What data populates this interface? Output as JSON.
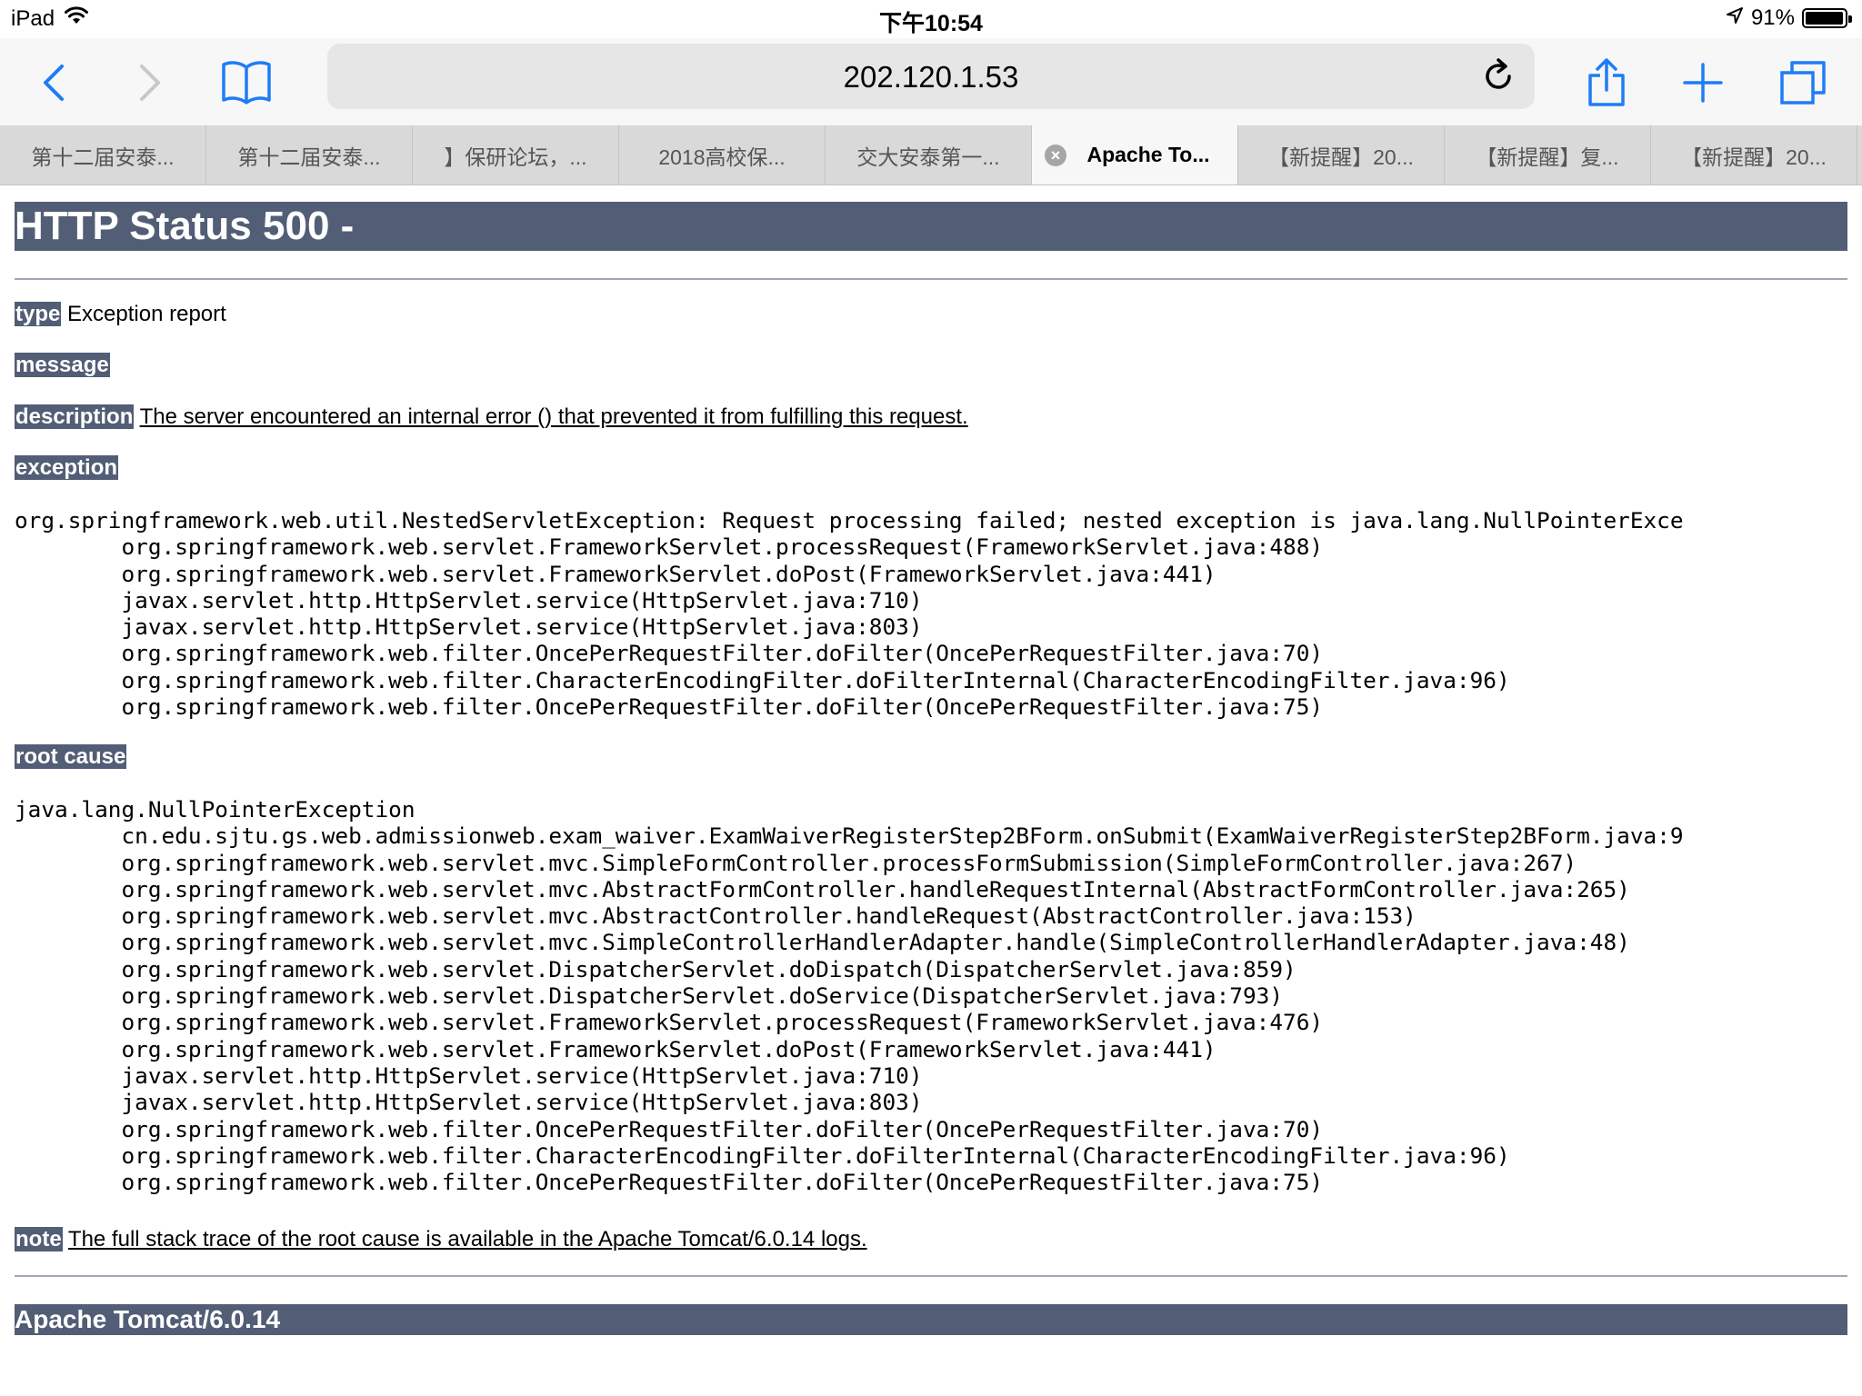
{
  "status_bar": {
    "device": "iPad",
    "time": "下午10:54",
    "battery": "91%"
  },
  "browser": {
    "url": "202.120.1.53",
    "tabs": [
      {
        "label": "第十二届安泰..."
      },
      {
        "label": "第十二届安泰..."
      },
      {
        "label": "】保研论坛，..."
      },
      {
        "label": "2018高校保..."
      },
      {
        "label": "交大安泰第一..."
      },
      {
        "label": "Apache To...",
        "active": true
      },
      {
        "label": "【新提醒】20..."
      },
      {
        "label": "【新提醒】复..."
      },
      {
        "label": "【新提醒】20..."
      }
    ]
  },
  "page": {
    "title": "HTTP Status 500 -",
    "type_label": "type",
    "type_value": "Exception report",
    "message_label": "message",
    "description_label": "description",
    "description_value": "The server encountered an internal error () that prevented it from fulfilling this request.",
    "exception_label": "exception",
    "exception_trace": "org.springframework.web.util.NestedServletException: Request processing failed; nested exception is java.lang.NullPointerExce\n\torg.springframework.web.servlet.FrameworkServlet.processRequest(FrameworkServlet.java:488)\n\torg.springframework.web.servlet.FrameworkServlet.doPost(FrameworkServlet.java:441)\n\tjavax.servlet.http.HttpServlet.service(HttpServlet.java:710)\n\tjavax.servlet.http.HttpServlet.service(HttpServlet.java:803)\n\torg.springframework.web.filter.OncePerRequestFilter.doFilter(OncePerRequestFilter.java:70)\n\torg.springframework.web.filter.CharacterEncodingFilter.doFilterInternal(CharacterEncodingFilter.java:96)\n\torg.springframework.web.filter.OncePerRequestFilter.doFilter(OncePerRequestFilter.java:75)",
    "root_cause_label": "root cause",
    "root_cause_trace": "java.lang.NullPointerException\n\tcn.edu.sjtu.gs.web.admissionweb.exam_waiver.ExamWaiverRegisterStep2BForm.onSubmit(ExamWaiverRegisterStep2BForm.java:9\n\torg.springframework.web.servlet.mvc.SimpleFormController.processFormSubmission(SimpleFormController.java:267)\n\torg.springframework.web.servlet.mvc.AbstractFormController.handleRequestInternal(AbstractFormController.java:265)\n\torg.springframework.web.servlet.mvc.AbstractController.handleRequest(AbstractController.java:153)\n\torg.springframework.web.servlet.mvc.SimpleControllerHandlerAdapter.handle(SimpleControllerHandlerAdapter.java:48)\n\torg.springframework.web.servlet.DispatcherServlet.doDispatch(DispatcherServlet.java:859)\n\torg.springframework.web.servlet.DispatcherServlet.doService(DispatcherServlet.java:793)\n\torg.springframework.web.servlet.FrameworkServlet.processRequest(FrameworkServlet.java:476)\n\torg.springframework.web.servlet.FrameworkServlet.doPost(FrameworkServlet.java:441)\n\tjavax.servlet.http.HttpServlet.service(HttpServlet.java:710)\n\tjavax.servlet.http.HttpServlet.service(HttpServlet.java:803)\n\torg.springframework.web.filter.OncePerRequestFilter.doFilter(OncePerRequestFilter.java:70)\n\torg.springframework.web.filter.CharacterEncodingFilter.doFilterInternal(CharacterEncodingFilter.java:96)\n\torg.springframework.web.filter.OncePerRequestFilter.doFilter(OncePerRequestFilter.java:75)",
    "note_label": "note",
    "note_value": "The full stack trace of the root cause is available in the Apache Tomcat/6.0.14 logs.",
    "footer": "Apache Tomcat/6.0.14"
  },
  "colors": {
    "header_bg": "#525d76",
    "accent_blue": "#1f7cf6",
    "disabled_gray": "#c7c7cc"
  }
}
